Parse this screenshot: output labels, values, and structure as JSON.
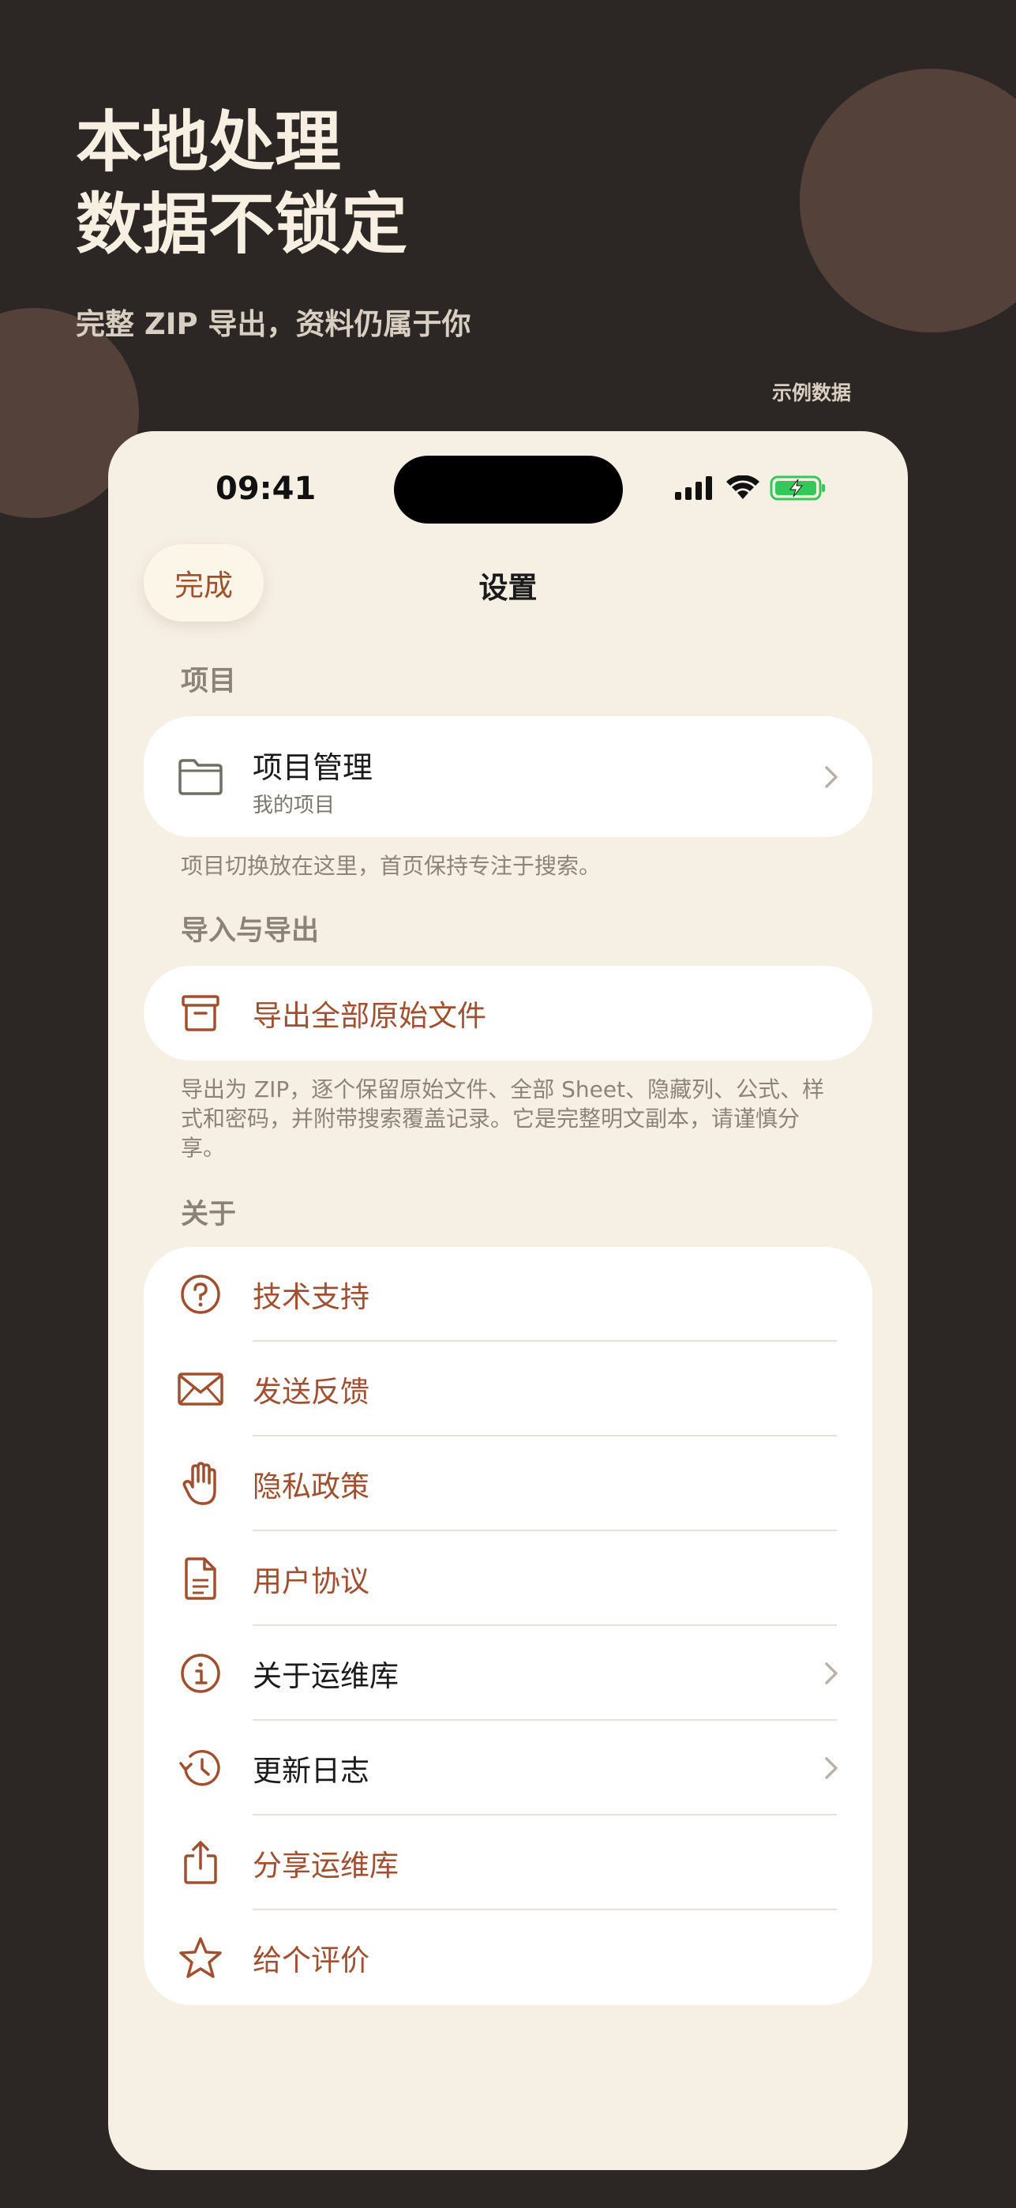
{
  "hero": {
    "title_line1": "本地处理",
    "title_line2": "数据不锁定",
    "subtitle": "完整 ZIP 导出，资料仍属于你",
    "sample_tag": "示例数据"
  },
  "status_bar": {
    "time": "09:41"
  },
  "nav": {
    "done_label": "完成",
    "title": "设置"
  },
  "sections": {
    "project": {
      "header": "项目",
      "item": {
        "title": "项目管理",
        "subtitle": "我的项目",
        "icon": "folder-icon"
      },
      "footer": "项目切换放在这里，首页保持专注于搜索。"
    },
    "import_export": {
      "header": "导入与导出",
      "item": {
        "label": "导出全部原始文件",
        "icon": "archive-icon"
      },
      "footer": "导出为 ZIP，逐个保留原始文件、全部 Sheet、隐藏列、公式、样式和密码，并附带搜索覆盖记录。它是完整明文副本，请谨慎分享。"
    },
    "about": {
      "header": "关于",
      "items": [
        {
          "label": "技术支持",
          "icon": "question-circle-icon"
        },
        {
          "label": "发送反馈",
          "icon": "envelope-icon"
        },
        {
          "label": "隐私政策",
          "icon": "hand-icon"
        },
        {
          "label": "用户协议",
          "icon": "document-icon"
        },
        {
          "label": "关于运维库",
          "icon": "info-circle-icon"
        },
        {
          "label": "更新日志",
          "icon": "history-icon"
        },
        {
          "label": "分享运维库",
          "icon": "share-icon"
        },
        {
          "label": "给个评价",
          "icon": "star-icon"
        }
      ]
    }
  },
  "colors": {
    "background": "#2c2724",
    "blob": "#54413a",
    "phone_background": "#f6f0e4",
    "accent": "#a0502f",
    "battery": "#34c759"
  }
}
